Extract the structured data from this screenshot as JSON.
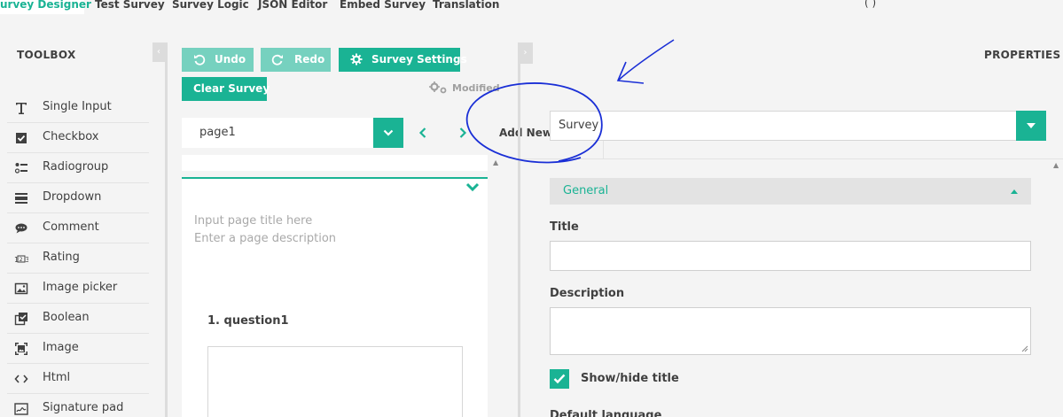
{
  "tabs": [
    {
      "label": "urvey Designer",
      "active": true
    },
    {
      "label": "Test Survey"
    },
    {
      "label": "Survey Logic"
    },
    {
      "label": "JSON Editor"
    },
    {
      "label": "Embed Survey"
    },
    {
      "label": "Translation"
    }
  ],
  "topright_fragment": "(                   )",
  "toolbox": {
    "title": "TOOLBOX",
    "items": [
      {
        "label": "Single Input",
        "icon": "text-icon"
      },
      {
        "label": "Checkbox",
        "icon": "checkbox-icon"
      },
      {
        "label": "Radiogroup",
        "icon": "radiogroup-icon"
      },
      {
        "label": "Dropdown",
        "icon": "dropdown-icon"
      },
      {
        "label": "Comment",
        "icon": "comment-icon"
      },
      {
        "label": "Rating",
        "icon": "rating-icon"
      },
      {
        "label": "Image picker",
        "icon": "image-picker-icon"
      },
      {
        "label": "Boolean",
        "icon": "boolean-icon"
      },
      {
        "label": "Image",
        "icon": "image-icon"
      },
      {
        "label": "Html",
        "icon": "html-icon"
      },
      {
        "label": "Signature pad",
        "icon": "signature-icon"
      }
    ]
  },
  "toolbar": {
    "undo": "Undo",
    "redo": "Redo",
    "settings": "Survey Settings",
    "clear": "Clear Survey",
    "status": "Modified"
  },
  "page": {
    "selected": "page1",
    "add_new": "Add New P",
    "title_placeholder": "Input page title here",
    "description_placeholder": "Enter a page description",
    "question_title": "1. question1"
  },
  "properties": {
    "title": "PROPERTIES",
    "object": "Survey",
    "section": "General",
    "title_label": "Title",
    "title_value": "",
    "description_label": "Description",
    "description_value": "",
    "show_title_label": "Show/hide title",
    "show_title_checked": true,
    "default_language_label": "Default language"
  },
  "colors": {
    "accent": "#1ab394",
    "accent_light": "#76d1bf",
    "annotation": "#1a2fd6"
  }
}
